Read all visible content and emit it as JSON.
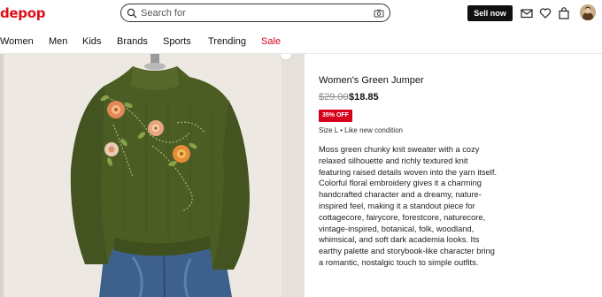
{
  "brand": {
    "logo_text": "depop",
    "logo_color": "#e0101a"
  },
  "search": {
    "placeholder": "Search for"
  },
  "header": {
    "sell_label": "Sell now",
    "icons": [
      "mail-icon",
      "heart-icon",
      "shopping-bag-icon",
      "user-avatar"
    ]
  },
  "nav": {
    "items": [
      {
        "label": "Women"
      },
      {
        "label": "Men"
      },
      {
        "label": "Kids"
      },
      {
        "label": "Brands"
      },
      {
        "label": "Sports"
      },
      {
        "label": "Trending"
      },
      {
        "label": "Sale",
        "color": "#d6001c"
      }
    ]
  },
  "product": {
    "title": "Women's Green Jumper",
    "original_price": "$29.00",
    "price": "$18.85",
    "discount_badge": "35% OFF",
    "condition": "Size L • Like new condition",
    "description": "Moss green chunky knit sweater with a cozy relaxed silhouette and richly textured knit featuring raised details woven into the yarn itself. Colorful floral embroidery gives it a charming handcrafted character and a dreamy, nature-inspired feel, making it a standout piece for cottagecore, fairycore, forestcore, naturecore, vintage-inspired, botanical, folk, woodland, whimsical, and soft dark academia looks. Its earthy palette and storybook-like character bring a romantic, nostalgic touch to simple outfits."
  },
  "colors": {
    "accent": "#d6001c",
    "sweater": "#4a5c22",
    "denim": "#3a5f8a"
  }
}
